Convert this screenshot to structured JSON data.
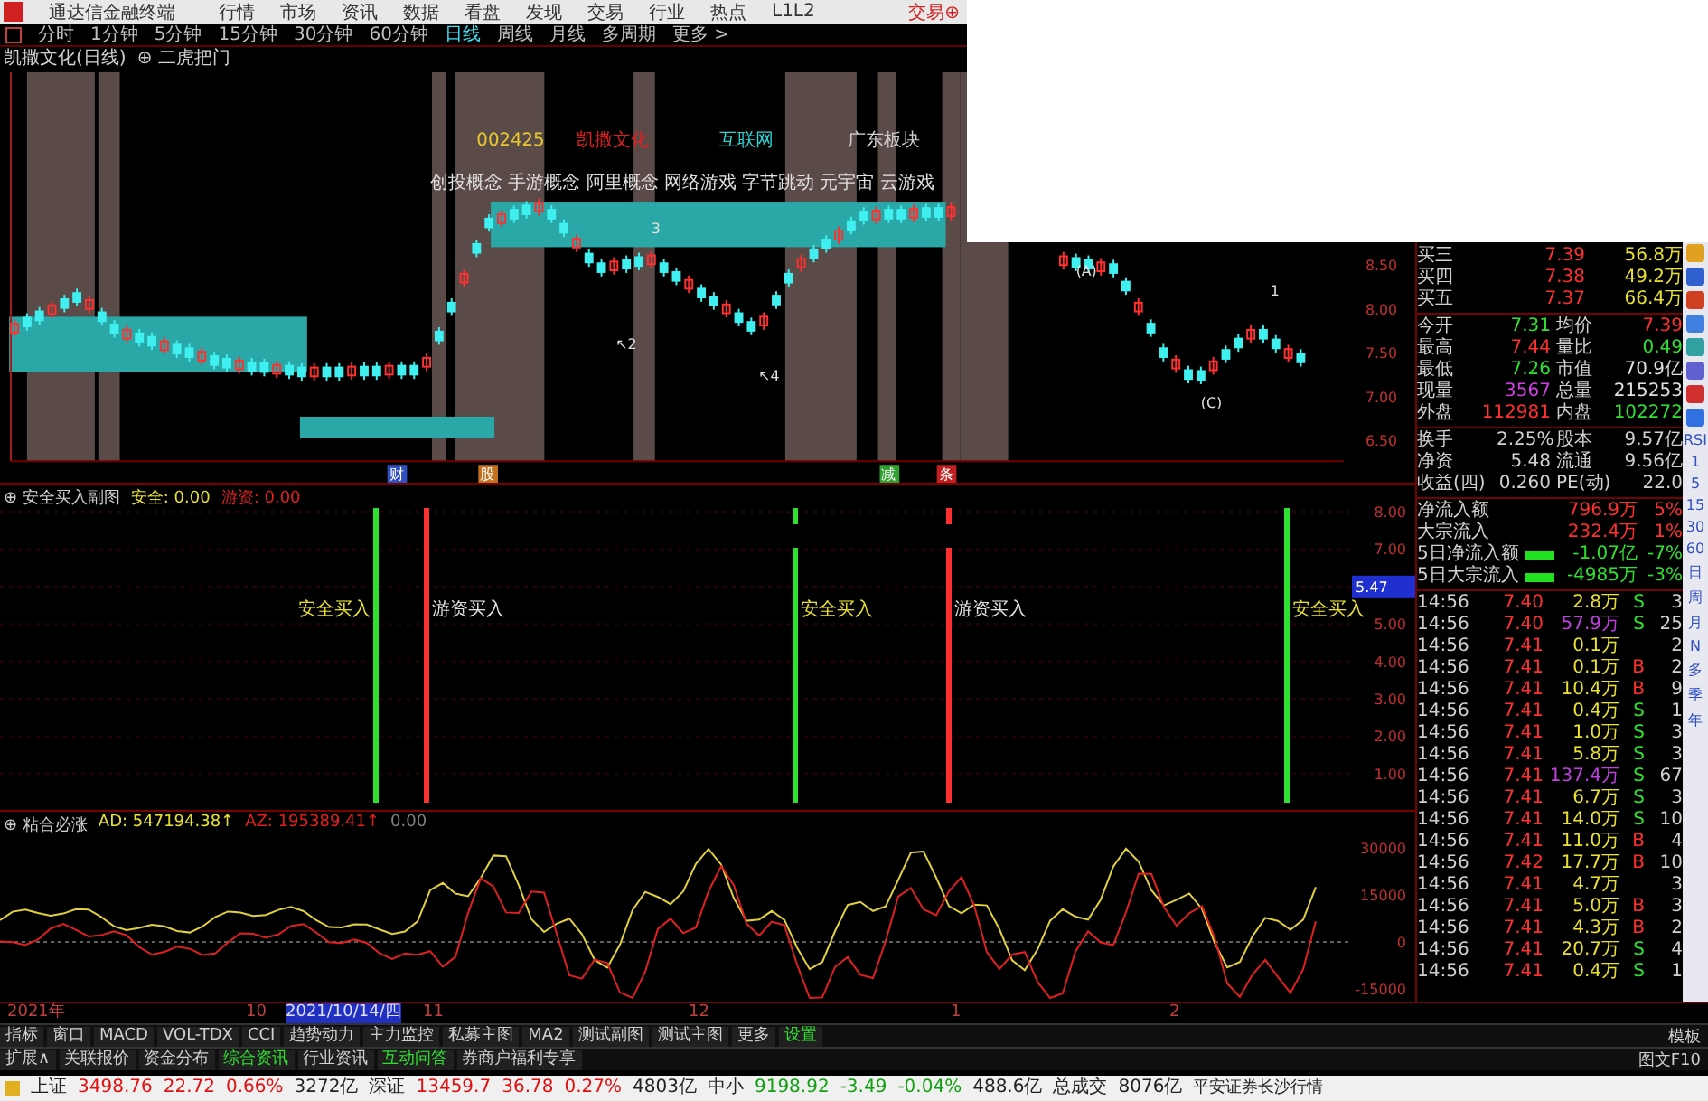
{
  "menu_bar": {
    "app_title": "通达信金融终端",
    "items": [
      "行情",
      "市场",
      "资讯",
      "数据",
      "看盘",
      "发现",
      "交易",
      "行业",
      "热点",
      "L1L2"
    ],
    "trade_button": "交易⊕"
  },
  "period_bar": {
    "items": [
      {
        "label": "分时",
        "selected": false
      },
      {
        "label": "1分钟",
        "selected": false
      },
      {
        "label": "5分钟",
        "selected": false
      },
      {
        "label": "15分钟",
        "selected": false
      },
      {
        "label": "30分钟",
        "selected": false
      },
      {
        "label": "60分钟",
        "selected": false
      },
      {
        "label": "日线",
        "selected": true
      },
      {
        "label": "周线",
        "selected": false
      },
      {
        "label": "月线",
        "selected": false
      },
      {
        "label": "多周期",
        "selected": false
      },
      {
        "label": "更多 >",
        "selected": false
      }
    ]
  },
  "chart_title": {
    "stock": "凯撒文化(日线)",
    "indicator": "⊕ 二虎把门"
  },
  "main_chart": {
    "chart_data": {
      "type": "candlestick",
      "ylim": [
        6.26,
        10.7
      ],
      "ohlc": [
        [
          7.73,
          7.88,
          7.68,
          7.83
        ],
        [
          7.9,
          7.95,
          7.75,
          7.8
        ],
        [
          7.97,
          8.02,
          7.82,
          7.87
        ],
        [
          7.94,
          8.09,
          7.89,
          8.04
        ],
        [
          8.11,
          8.16,
          7.96,
          8.01
        ],
        [
          8.18,
          8.23,
          8.03,
          8.08
        ],
        [
          8.0,
          8.15,
          7.95,
          8.1
        ],
        [
          7.96,
          8.01,
          7.81,
          7.86
        ],
        [
          7.82,
          7.87,
          7.67,
          7.72
        ],
        [
          7.66,
          7.81,
          7.61,
          7.76
        ],
        [
          7.72,
          7.77,
          7.57,
          7.62
        ],
        [
          7.68,
          7.73,
          7.53,
          7.58
        ],
        [
          7.53,
          7.68,
          7.48,
          7.63
        ],
        [
          7.59,
          7.64,
          7.44,
          7.49
        ],
        [
          7.55,
          7.6,
          7.4,
          7.45
        ],
        [
          7.41,
          7.56,
          7.36,
          7.51
        ],
        [
          7.46,
          7.51,
          7.31,
          7.36
        ],
        [
          7.43,
          7.48,
          7.28,
          7.33
        ],
        [
          7.31,
          7.46,
          7.26,
          7.41
        ],
        [
          7.39,
          7.44,
          7.24,
          7.29
        ],
        [
          7.38,
          7.43,
          7.23,
          7.28
        ],
        [
          7.26,
          7.41,
          7.21,
          7.36
        ],
        [
          7.35,
          7.4,
          7.2,
          7.25
        ],
        [
          7.33,
          7.38,
          7.18,
          7.23
        ],
        [
          7.23,
          7.38,
          7.18,
          7.33
        ],
        [
          7.33,
          7.38,
          7.18,
          7.23
        ],
        [
          7.33,
          7.38,
          7.18,
          7.23
        ],
        [
          7.24,
          7.39,
          7.19,
          7.34
        ],
        [
          7.34,
          7.39,
          7.19,
          7.24
        ],
        [
          7.34,
          7.39,
          7.19,
          7.24
        ],
        [
          7.25,
          7.4,
          7.2,
          7.35
        ],
        [
          7.35,
          7.4,
          7.2,
          7.25
        ],
        [
          7.35,
          7.4,
          7.2,
          7.25
        ],
        [
          7.34,
          7.49,
          7.29,
          7.44
        ],
        [
          7.74,
          7.79,
          7.59,
          7.64
        ],
        [
          8.07,
          8.12,
          7.92,
          7.97
        ],
        [
          8.3,
          8.45,
          8.25,
          8.4
        ],
        [
          8.74,
          8.79,
          8.59,
          8.64
        ],
        [
          9.03,
          9.08,
          8.88,
          8.93
        ],
        [
          8.98,
          9.13,
          8.93,
          9.08
        ],
        [
          9.13,
          9.18,
          8.98,
          9.03
        ],
        [
          9.18,
          9.23,
          9.03,
          9.08
        ],
        [
          9.11,
          9.26,
          9.06,
          9.21
        ],
        [
          9.13,
          9.18,
          8.98,
          9.03
        ],
        [
          8.97,
          9.02,
          8.82,
          8.87
        ],
        [
          8.7,
          8.85,
          8.65,
          8.8
        ],
        [
          8.63,
          8.68,
          8.48,
          8.53
        ],
        [
          8.52,
          8.57,
          8.37,
          8.42
        ],
        [
          8.44,
          8.59,
          8.39,
          8.54
        ],
        [
          8.56,
          8.61,
          8.41,
          8.46
        ],
        [
          8.59,
          8.64,
          8.44,
          8.49
        ],
        [
          8.51,
          8.66,
          8.46,
          8.61
        ],
        [
          8.52,
          8.57,
          8.37,
          8.42
        ],
        [
          8.42,
          8.47,
          8.27,
          8.32
        ],
        [
          8.23,
          8.38,
          8.18,
          8.33
        ],
        [
          8.23,
          8.28,
          8.08,
          8.13
        ],
        [
          8.14,
          8.19,
          7.99,
          8.04
        ],
        [
          7.95,
          8.1,
          7.9,
          8.05
        ],
        [
          7.95,
          8.0,
          7.8,
          7.85
        ],
        [
          7.85,
          7.9,
          7.7,
          7.75
        ],
        [
          7.81,
          7.96,
          7.76,
          7.91
        ],
        [
          8.15,
          8.2,
          8.0,
          8.05
        ],
        [
          8.4,
          8.45,
          8.25,
          8.3
        ],
        [
          8.47,
          8.62,
          8.42,
          8.57
        ],
        [
          8.68,
          8.73,
          8.53,
          8.58
        ],
        [
          8.79,
          8.84,
          8.64,
          8.69
        ],
        [
          8.79,
          8.94,
          8.74,
          8.89
        ],
        [
          9.0,
          9.05,
          8.85,
          8.9
        ],
        [
          9.11,
          9.16,
          8.96,
          9.01
        ],
        [
          9.02,
          9.17,
          8.97,
          9.12
        ],
        [
          9.13,
          9.18,
          8.98,
          9.03
        ],
        [
          9.13,
          9.18,
          8.98,
          9.03
        ],
        [
          9.04,
          9.19,
          8.99,
          9.14
        ],
        [
          9.15,
          9.2,
          9.0,
          9.05
        ],
        [
          9.15,
          9.2,
          9.0,
          9.05
        ],
        [
          9.06,
          9.21,
          9.01,
          9.16
        ],
        null,
        null,
        null,
        null,
        null,
        null,
        null,
        null,
        [
          8.5,
          8.65,
          8.45,
          8.6
        ],
        [
          8.58,
          8.63,
          8.43,
          8.48
        ],
        [
          8.56,
          8.61,
          8.41,
          8.46
        ],
        [
          8.43,
          8.58,
          8.38,
          8.53
        ],
        [
          8.51,
          8.56,
          8.36,
          8.41
        ],
        [
          8.31,
          8.36,
          8.16,
          8.21
        ],
        [
          7.97,
          8.12,
          7.92,
          8.07
        ],
        [
          7.83,
          7.88,
          7.68,
          7.73
        ],
        [
          7.55,
          7.6,
          7.4,
          7.45
        ],
        [
          7.32,
          7.47,
          7.27,
          7.42
        ],
        [
          7.3,
          7.35,
          7.15,
          7.2
        ],
        [
          7.29,
          7.34,
          7.14,
          7.19
        ],
        [
          7.3,
          7.45,
          7.25,
          7.4
        ],
        [
          7.53,
          7.58,
          7.38,
          7.43
        ],
        [
          7.66,
          7.71,
          7.51,
          7.56
        ],
        [
          7.66,
          7.81,
          7.61,
          7.76
        ],
        [
          7.76,
          7.81,
          7.61,
          7.66
        ],
        [
          7.65,
          7.7,
          7.5,
          7.55
        ],
        [
          7.44,
          7.59,
          7.39,
          7.54
        ],
        [
          7.49,
          7.54,
          7.34,
          7.39
        ]
      ],
      "yticks": [
        {
          "value": 8.5,
          "label": "8.50"
        },
        {
          "value": 8,
          "label": "8.00"
        },
        {
          "value": 7.5,
          "label": "7.50"
        },
        {
          "value": 7,
          "label": "7.00"
        },
        {
          "value": 6.5,
          "label": "6.50"
        }
      ]
    },
    "labels": [
      {
        "text": "002425",
        "color": "#e8c830"
      },
      {
        "text": "凯撒文化",
        "color": "#e02020"
      },
      {
        "text": "互联网",
        "color": "#30d0d0"
      },
      {
        "text": "广东板块",
        "color": "#d0d0d0"
      }
    ],
    "concepts": "创投概念 手游概念 阿里概念 网络游戏 字节跳动 元宇宙 云游戏",
    "markers": [
      "3",
      "↖2",
      "↖4",
      "(A)",
      "1",
      "(C)"
    ],
    "event_tags": [
      {
        "text": "财",
        "color": "#3050c0"
      },
      {
        "text": "股",
        "color": "#c07020"
      },
      {
        "text": "减",
        "color": "#30a030"
      },
      {
        "text": "条",
        "color": "#c02020"
      }
    ]
  },
  "signal_chart": {
    "title": "⊕ 安全买入副图",
    "values": [
      {
        "text": "安全: 0.00",
        "color": "#e8e030"
      },
      {
        "text": "游资: 0.00",
        "color": "#e02020"
      }
    ],
    "y_ticks": [
      "8.00",
      "7.00",
      "5.00",
      "4.00",
      "3.00",
      "2.00",
      "1.00"
    ],
    "current_value": "5.47",
    "signals": [
      {
        "label": "安全买入",
        "kind": "safe"
      },
      {
        "label": "游资买入",
        "kind": "hot"
      },
      {
        "label": "安全买入",
        "kind": "safe"
      },
      {
        "label": "游资买入",
        "kind": "hot"
      },
      {
        "label": "安全买入",
        "kind": "safe"
      }
    ]
  },
  "oscillator_chart": {
    "title": "⊕ 粘合必涨",
    "values": [
      {
        "text": "AD: 547194.38↑",
        "color": "#e8e030"
      },
      {
        "text": "AZ: 195389.41↑",
        "color": "#e02020"
      },
      {
        "text": "0.00",
        "color": "#808080"
      }
    ],
    "y_ticks": [
      "30000",
      "15000",
      "0",
      "-15000"
    ]
  },
  "quote_panel": {
    "order_rows": [
      {
        "label": "买三",
        "price": "7.39",
        "volume": "56.8万"
      },
      {
        "label": "买四",
        "price": "7.38",
        "volume": "49.2万"
      },
      {
        "label": "买五",
        "price": "7.37",
        "volume": "66.4万"
      }
    ],
    "stats": [
      {
        "label": "今开",
        "value": "7.31",
        "color": "#30e030"
      },
      {
        "label": "均价",
        "value": "7.39",
        "color": "#ff3030"
      },
      {
        "label": "最高",
        "value": "7.44",
        "color": "#ff3030"
      },
      {
        "label": "量比",
        "value": "0.49",
        "color": "#30e030"
      },
      {
        "label": "最低",
        "value": "7.26",
        "color": "#30e030"
      },
      {
        "label": "市值",
        "value": "70.9亿",
        "color": "#e0e0e0"
      },
      {
        "label": "现量",
        "value": "3567",
        "color": "#d040e0"
      },
      {
        "label": "总量",
        "value": "215253",
        "color": "#e0e0e0"
      },
      {
        "label": "外盘",
        "value": "112981",
        "color": "#ff3030"
      },
      {
        "label": "内盘",
        "value": "102272",
        "color": "#30e030"
      }
    ],
    "fundamentals": [
      {
        "label": "换手",
        "value": "2.25%"
      },
      {
        "label": "股本",
        "value": "9.57亿"
      },
      {
        "label": "净资",
        "value": "5.48"
      },
      {
        "label": "流通",
        "value": "9.56亿"
      },
      {
        "label": "收益(四)",
        "value": "0.260"
      },
      {
        "label": "PE(动)",
        "value": "22.0"
      }
    ],
    "money_flow": [
      {
        "label": "净流入额",
        "kind": "plain",
        "value": "796.9万",
        "percent": "5%",
        "color": "#ff3030"
      },
      {
        "label": "大宗流入",
        "kind": "plain",
        "value": "232.4万",
        "percent": "1%",
        "color": "#ff3030"
      },
      {
        "label": "5日净流入额",
        "kind": "bar",
        "value": "-1.07亿",
        "percent": "-7%",
        "color": "#30e030"
      },
      {
        "label": "5日大宗流入",
        "kind": "bar",
        "value": "-4985万",
        "percent": "-3%",
        "color": "#30e030"
      }
    ],
    "ticks": [
      {
        "time": "14:56",
        "price": "7.40",
        "volume": "2.8万",
        "large": false,
        "side": "S",
        "kind": "sell",
        "count": "3"
      },
      {
        "time": "14:56",
        "price": "7.40",
        "volume": "57.9万",
        "large": true,
        "side": "S",
        "kind": "sell",
        "count": "25"
      },
      {
        "time": "14:56",
        "price": "7.41",
        "volume": "0.1万",
        "large": false,
        "kind": "none",
        "count": "2"
      },
      {
        "time": "14:56",
        "price": "7.41",
        "volume": "0.1万",
        "large": false,
        "side": "B",
        "kind": "buy",
        "count": "2"
      },
      {
        "time": "14:56",
        "price": "7.41",
        "volume": "10.4万",
        "large": false,
        "side": "B",
        "kind": "buy",
        "count": "9"
      },
      {
        "time": "14:56",
        "price": "7.41",
        "volume": "0.4万",
        "large": false,
        "side": "S",
        "kind": "sell",
        "count": "1"
      },
      {
        "time": "14:56",
        "price": "7.41",
        "volume": "1.0万",
        "large": false,
        "side": "S",
        "kind": "sell",
        "count": "3"
      },
      {
        "time": "14:56",
        "price": "7.41",
        "volume": "5.8万",
        "large": false,
        "side": "S",
        "kind": "sell",
        "count": "3"
      },
      {
        "time": "14:56",
        "price": "7.41",
        "volume": "137.4万",
        "large": true,
        "side": "S",
        "kind": "sell",
        "count": "67"
      },
      {
        "time": "14:56",
        "price": "7.41",
        "volume": "6.7万",
        "large": false,
        "side": "S",
        "kind": "sell",
        "count": "3"
      },
      {
        "time": "14:56",
        "price": "7.41",
        "volume": "14.0万",
        "large": false,
        "side": "S",
        "kind": "sell",
        "count": "10"
      },
      {
        "time": "14:56",
        "price": "7.41",
        "volume": "11.0万",
        "large": false,
        "side": "B",
        "kind": "buy",
        "count": "4"
      },
      {
        "time": "14:56",
        "price": "7.42",
        "volume": "17.7万",
        "large": false,
        "side": "B",
        "kind": "buy",
        "count": "10"
      },
      {
        "time": "14:56",
        "price": "7.41",
        "volume": "4.7万",
        "large": false,
        "kind": "none",
        "count": "3"
      },
      {
        "time": "14:56",
        "price": "7.41",
        "volume": "5.0万",
        "large": false,
        "side": "B",
        "kind": "buy",
        "count": "3"
      },
      {
        "time": "14:56",
        "price": "7.41",
        "volume": "4.3万",
        "large": false,
        "side": "B",
        "kind": "buy",
        "count": "2"
      },
      {
        "time": "14:56",
        "price": "7.41",
        "volume": "20.7万",
        "large": false,
        "side": "S",
        "kind": "sell",
        "count": "4"
      },
      {
        "time": "14:56",
        "price": "7.41",
        "volume": "0.4万",
        "large": false,
        "side": "S",
        "kind": "sell",
        "count": "1"
      }
    ]
  },
  "side_toolbar": {
    "labels": [
      "RSI",
      "1",
      "5",
      "15",
      "30",
      "60",
      "日",
      "周",
      "月",
      "N",
      "多",
      "季",
      "年"
    ]
  },
  "date_axis": [
    {
      "text": "2021年",
      "highlighted": false
    },
    {
      "text": "10",
      "highlighted": false
    },
    {
      "text": "2021/10/14/四",
      "highlighted": true
    },
    {
      "text": "11",
      "highlighted": false
    },
    {
      "text": "12",
      "highlighted": false
    },
    {
      "text": "1",
      "highlighted": false
    },
    {
      "text": "2",
      "highlighted": false
    }
  ],
  "indicator_tabs": {
    "items": [
      {
        "label": "指标",
        "accent": false
      },
      {
        "label": "窗口",
        "accent": false
      },
      {
        "label": "MACD",
        "accent": false
      },
      {
        "label": "VOL-TDX",
        "accent": false
      },
      {
        "label": "CCI",
        "accent": false
      },
      {
        "label": "趋势动力",
        "accent": false
      },
      {
        "label": "主力监控",
        "accent": false
      },
      {
        "label": "私募主图",
        "accent": false
      },
      {
        "label": "MA2",
        "accent": false
      },
      {
        "label": "测试副图",
        "accent": false
      },
      {
        "label": "测试主图",
        "accent": false
      },
      {
        "label": "更多",
        "accent": false
      },
      {
        "label": "设置",
        "accent": true
      }
    ],
    "right": "模板"
  },
  "info_tabs": {
    "items": [
      {
        "label": "扩展∧",
        "accent": false
      },
      {
        "label": "关联报价",
        "accent": false
      },
      {
        "label": "资金分布",
        "accent": false
      },
      {
        "label": "综合资讯",
        "accent": true
      },
      {
        "label": "行业资讯",
        "accent": false
      },
      {
        "label": "互动问答",
        "accent": true
      },
      {
        "label": "券商户福利专享",
        "accent": false
      }
    ],
    "right": "图文F10"
  },
  "status_bar": {
    "indices": [
      {
        "name": "上证",
        "value": "3498.76",
        "change": "22.72",
        "percent": "0.66%",
        "amount": "3272亿",
        "color": "#e01010"
      },
      {
        "name": "深证",
        "value": "13459.7",
        "change": "36.78",
        "percent": "0.27%",
        "amount": "4803亿",
        "color": "#e01010"
      },
      {
        "name": "中小",
        "value": "9198.92",
        "change": "-3.49",
        "percent": "-0.04%",
        "amount": "488.6亿",
        "color": "#10a010"
      }
    ],
    "total_label": "总成交",
    "total": "8076亿",
    "broker": "平安证券长沙行情"
  }
}
